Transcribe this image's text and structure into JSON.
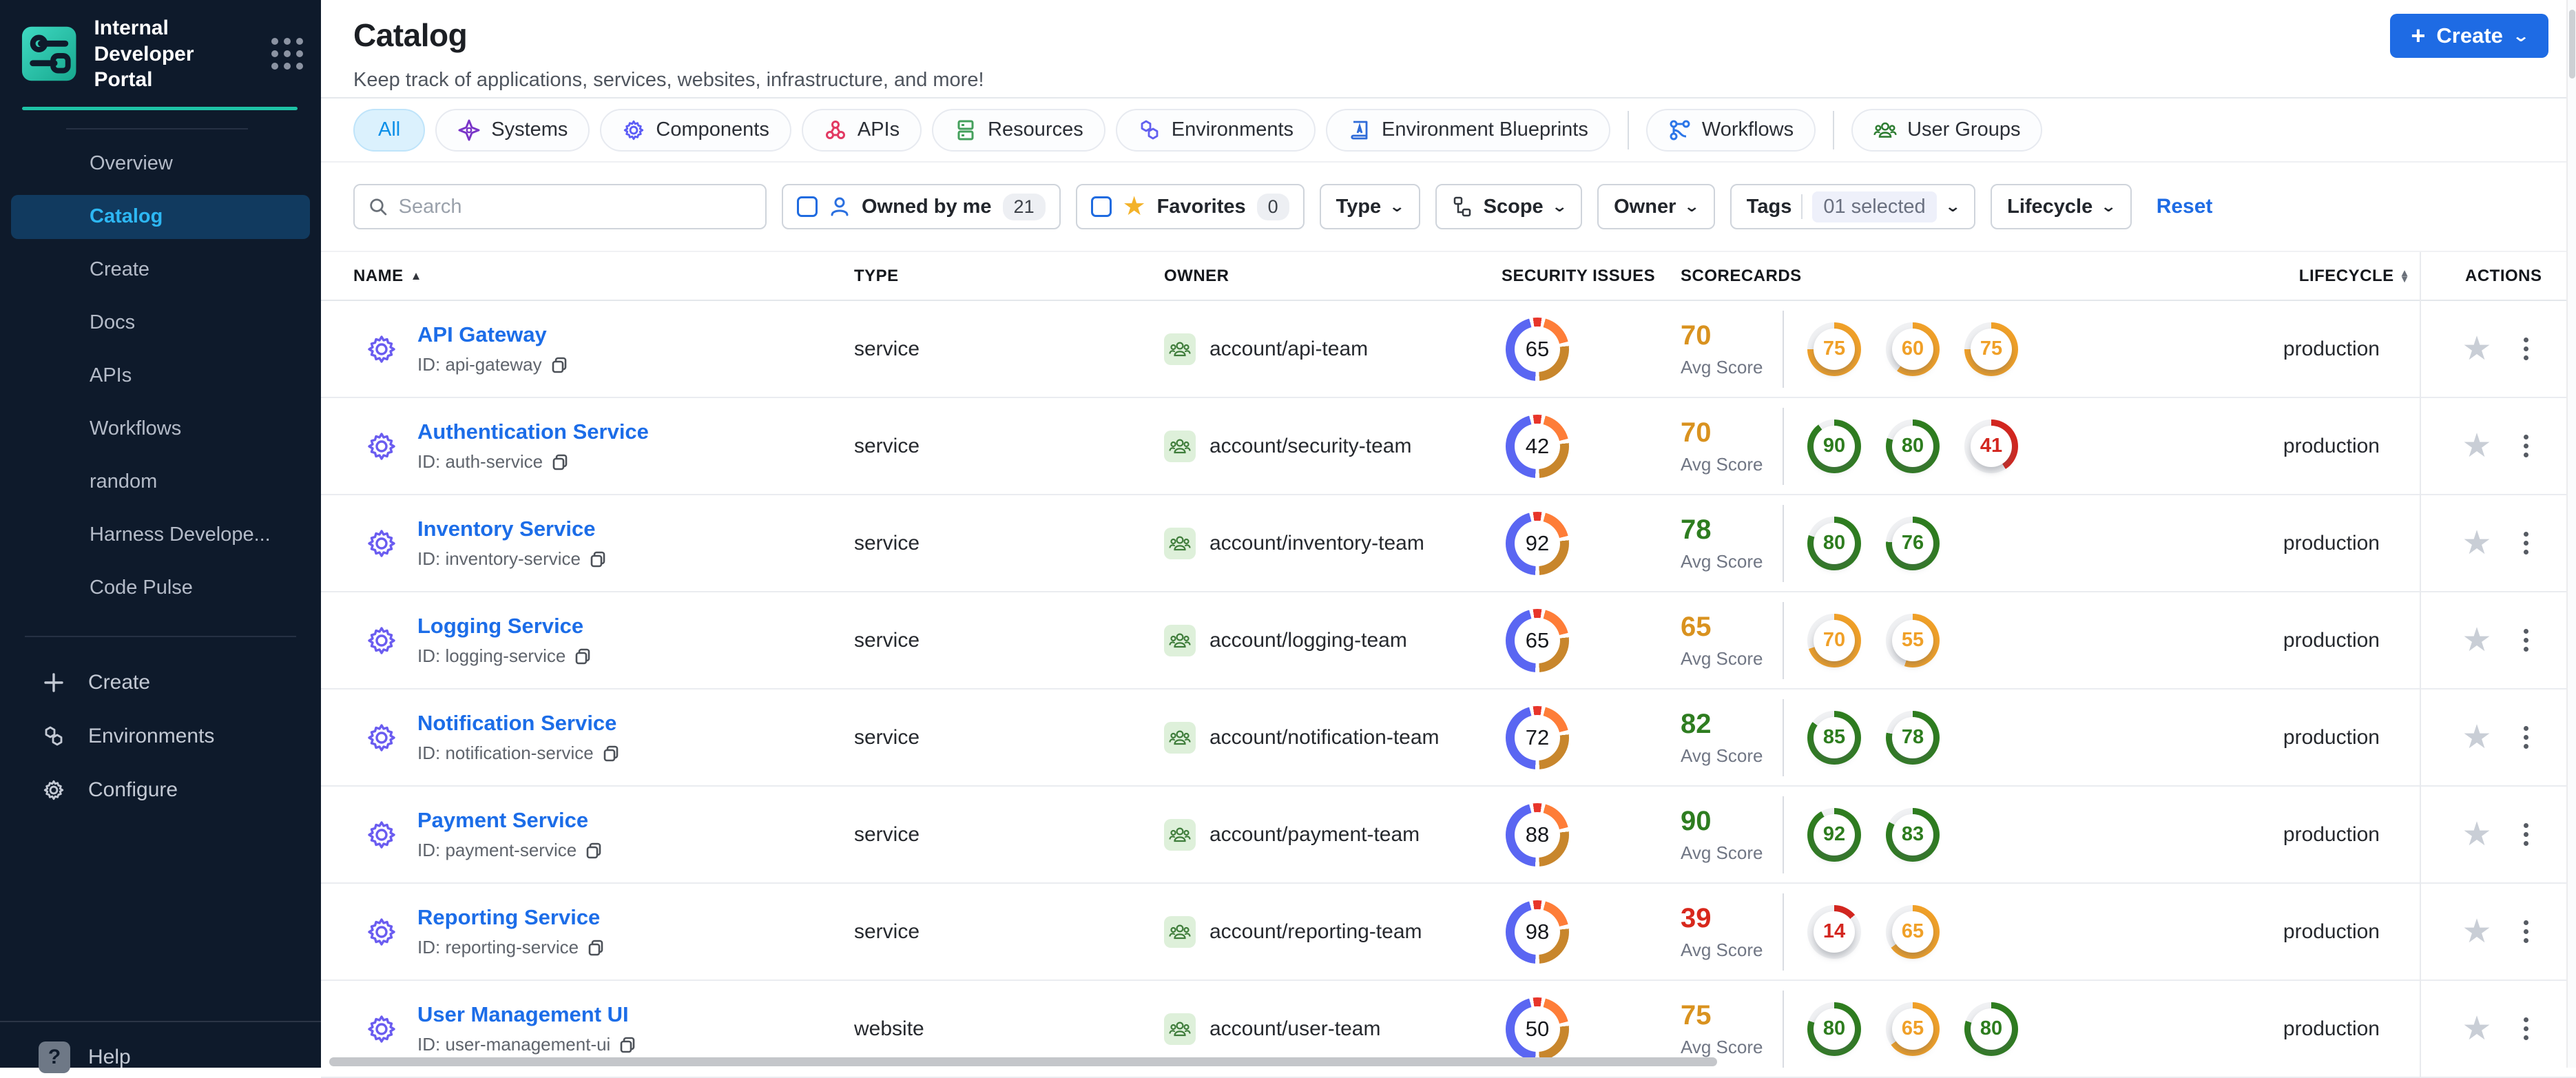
{
  "sidebar": {
    "brand_title": "Internal Developer Portal",
    "items": [
      {
        "label": "Overview",
        "active": false
      },
      {
        "label": "Catalog",
        "active": true
      },
      {
        "label": "Create",
        "active": false
      },
      {
        "label": "Docs",
        "active": false
      },
      {
        "label": "APIs",
        "active": false
      },
      {
        "label": "Workflows",
        "active": false
      },
      {
        "label": "random",
        "active": false
      },
      {
        "label": "Harness Develope...",
        "active": false
      },
      {
        "label": "Code Pulse",
        "active": false
      }
    ],
    "bottom_items": [
      {
        "label": "Create",
        "icon": "plus"
      },
      {
        "label": "Environments",
        "icon": "hexagons"
      },
      {
        "label": "Configure",
        "icon": "gear"
      }
    ],
    "help_label": "Help"
  },
  "header": {
    "title": "Catalog",
    "subtitle": "Keep track of applications, services, websites, infrastructure, and more!",
    "create_button": "Create"
  },
  "tabs": [
    {
      "label": "All",
      "icon": "none",
      "color": "#0b8fe8",
      "active": true,
      "sep_before": false
    },
    {
      "label": "Systems",
      "icon": "sparkle",
      "color": "#7a35c8",
      "active": false,
      "sep_before": false
    },
    {
      "label": "Components",
      "icon": "gear",
      "color": "#5d5df6",
      "active": false,
      "sep_before": false
    },
    {
      "label": "APIs",
      "icon": "share",
      "color": "#e23a63",
      "active": false,
      "sep_before": false
    },
    {
      "label": "Resources",
      "icon": "stack",
      "color": "#44a05c",
      "active": false,
      "sep_before": false
    },
    {
      "label": "Environments",
      "icon": "hexagons",
      "color": "#6360f0",
      "active": false,
      "sep_before": false
    },
    {
      "label": "Environment Blueprints",
      "icon": "blueprint",
      "color": "#2f6bd8",
      "active": false,
      "sep_before": false
    },
    {
      "label": "Workflows",
      "icon": "workflow",
      "color": "#2c76e8",
      "active": false,
      "sep_before": true
    },
    {
      "label": "User Groups",
      "icon": "users",
      "color": "#2e7d32",
      "active": false,
      "sep_before": true
    }
  ],
  "filters": {
    "search_placeholder": "Search",
    "owned_by_me": {
      "label": "Owned by me",
      "count": "21"
    },
    "favorites": {
      "label": "Favorites",
      "count": "0"
    },
    "type_label": "Type",
    "scope_label": "Scope",
    "owner_label": "Owner",
    "tags_label": "Tags",
    "tags_selected": "01 selected",
    "lifecycle_label": "Lifecycle",
    "reset_label": "Reset"
  },
  "table": {
    "columns": [
      "NAME",
      "TYPE",
      "OWNER",
      "SECURITY ISSUES",
      "SCORECARDS",
      "LIFECYCLE",
      "ACTIONS"
    ],
    "avg_caption": "Avg Score",
    "rows": [
      {
        "name": "API Gateway",
        "id": "ID: api-gateway",
        "type": "service",
        "owner": "account/api-team",
        "security": 65,
        "avg": 70,
        "avg_level": "orange",
        "scorecards": [
          {
            "value": 75,
            "level": "orange"
          },
          {
            "value": 60,
            "level": "orange"
          },
          {
            "value": 75,
            "level": "orange"
          }
        ],
        "lifecycle": "production"
      },
      {
        "name": "Authentication Service",
        "id": "ID: auth-service",
        "type": "service",
        "owner": "account/security-team",
        "security": 42,
        "avg": 70,
        "avg_level": "orange",
        "scorecards": [
          {
            "value": 90,
            "level": "green"
          },
          {
            "value": 80,
            "level": "green"
          },
          {
            "value": 41,
            "level": "red"
          }
        ],
        "lifecycle": "production"
      },
      {
        "name": "Inventory Service",
        "id": "ID: inventory-service",
        "type": "service",
        "owner": "account/inventory-team",
        "security": 92,
        "avg": 78,
        "avg_level": "green",
        "scorecards": [
          {
            "value": 80,
            "level": "green"
          },
          {
            "value": 76,
            "level": "green"
          }
        ],
        "lifecycle": "production"
      },
      {
        "name": "Logging Service",
        "id": "ID: logging-service",
        "type": "service",
        "owner": "account/logging-team",
        "security": 65,
        "avg": 65,
        "avg_level": "orange",
        "scorecards": [
          {
            "value": 70,
            "level": "orange"
          },
          {
            "value": 55,
            "level": "orange"
          }
        ],
        "lifecycle": "production"
      },
      {
        "name": "Notification Service",
        "id": "ID: notification-service",
        "type": "service",
        "owner": "account/notification-team",
        "security": 72,
        "avg": 82,
        "avg_level": "green",
        "scorecards": [
          {
            "value": 85,
            "level": "green"
          },
          {
            "value": 78,
            "level": "green"
          }
        ],
        "lifecycle": "production"
      },
      {
        "name": "Payment Service",
        "id": "ID: payment-service",
        "type": "service",
        "owner": "account/payment-team",
        "security": 88,
        "avg": 90,
        "avg_level": "green",
        "scorecards": [
          {
            "value": 92,
            "level": "green"
          },
          {
            "value": 83,
            "level": "green"
          }
        ],
        "lifecycle": "production"
      },
      {
        "name": "Reporting Service",
        "id": "ID: reporting-service",
        "type": "service",
        "owner": "account/reporting-team",
        "security": 98,
        "avg": 39,
        "avg_level": "red",
        "scorecards": [
          {
            "value": 14,
            "level": "red"
          },
          {
            "value": 65,
            "level": "orange"
          }
        ],
        "lifecycle": "production"
      },
      {
        "name": "User Management UI",
        "id": "ID: user-management-ui",
        "type": "website",
        "owner": "account/user-team",
        "security": 50,
        "avg": 75,
        "avg_level": "orange",
        "scorecards": [
          {
            "value": 80,
            "level": "green"
          },
          {
            "value": 65,
            "level": "orange"
          },
          {
            "value": 80,
            "level": "green"
          }
        ],
        "lifecycle": "production"
      }
    ]
  },
  "colors": {
    "green": "#2e7d1f",
    "orange": "#f0a028",
    "red": "#d3261f",
    "avg_green": "#2e7d20",
    "avg_orange": "#d9921f",
    "avg_red": "#d8281c",
    "accent_teal": "#1ec3a6",
    "primary_blue": "#1e6be4",
    "sidebar_bg": "#0e1a2b"
  }
}
